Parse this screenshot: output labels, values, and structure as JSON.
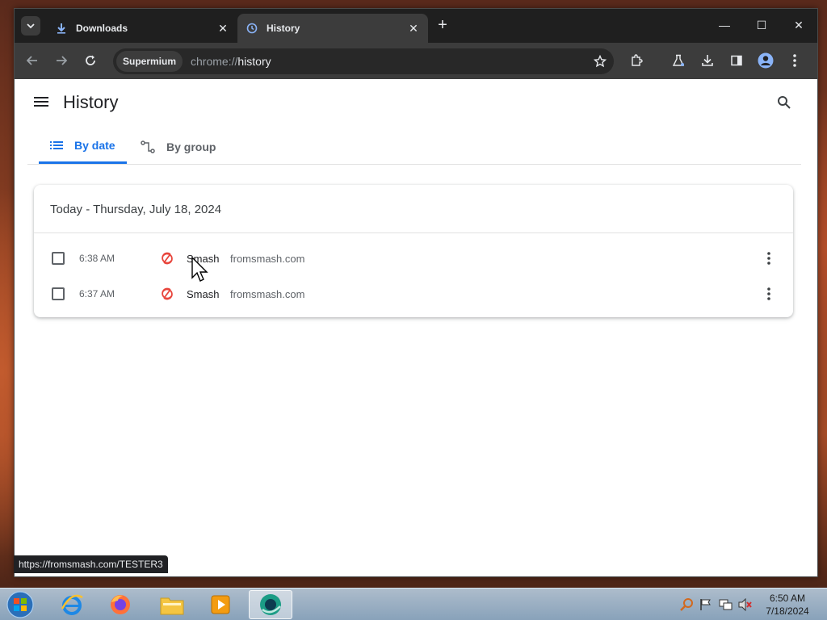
{
  "browser": {
    "tabs": [
      {
        "label": "Downloads",
        "icon": "download-icon",
        "active": false
      },
      {
        "label": "History",
        "icon": "history-icon",
        "active": true
      }
    ],
    "chip": "Supermium",
    "url_scheme": "chrome://",
    "url_path": "history",
    "status_url": "https://fromsmash.com/TESTER3"
  },
  "page": {
    "title": "History",
    "tabs": [
      {
        "label": "By date",
        "icon": "list-icon",
        "active": true
      },
      {
        "label": "By group",
        "icon": "group-icon",
        "active": false
      }
    ],
    "group_header": "Today - Thursday, July 18, 2024",
    "entries": [
      {
        "time": "6:38 AM",
        "title": "Smash",
        "domain": "fromsmash.com"
      },
      {
        "time": "6:37 AM",
        "title": "Smash",
        "domain": "fromsmash.com"
      }
    ]
  },
  "taskbar": {
    "time": "6:50 AM",
    "date": "7/18/2024"
  },
  "colors": {
    "accent": "#1a73e8",
    "chrome_dark": "#202124",
    "smash_red": "#e8453c"
  }
}
